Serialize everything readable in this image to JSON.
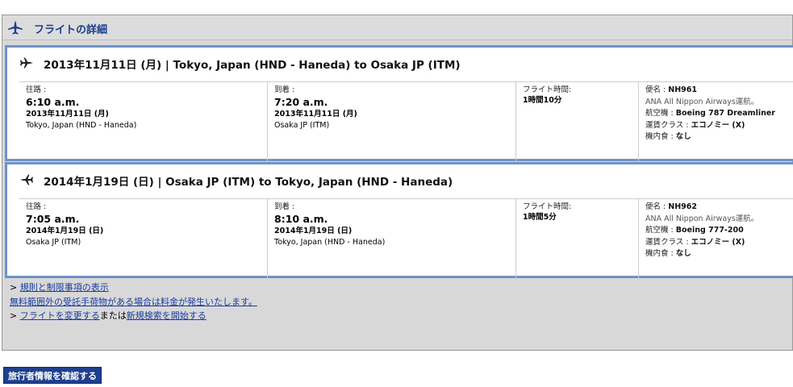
{
  "panel": {
    "title": "フライトの詳細"
  },
  "segments": [
    {
      "title": "2013年11月11日 (月) | Tokyo, Japan (HND - Haneda) to Osaka JP (ITM)",
      "depart_label": "往路 :",
      "depart_time": "6:10 a.m.",
      "depart_date": "2013年11月11日 (月)",
      "depart_place": "Tokyo, Japan (HND - Haneda)",
      "arrive_label": "到着 :",
      "arrive_time": "7:20 a.m.",
      "arrive_date": "2013年11月11日 (月)",
      "arrive_place": "Osaka JP (ITM)",
      "duration_label": "フライト時間:",
      "duration": "1時間10分",
      "flight_label": "便名 :",
      "flight_no": "NH961",
      "operator": "ANA All Nippon Airways運航。",
      "aircraft_label": "航空機 :",
      "aircraft": "Boeing 787 Dreamliner",
      "class_label": "運賃クラス :",
      "class": "エコノミー (X)",
      "meal_label": "機内食 :",
      "meal": "なし"
    },
    {
      "title": "2014年1月19日 (日) | Osaka JP (ITM) to Tokyo, Japan (HND - Haneda)",
      "depart_label": "往路 :",
      "depart_time": "7:05 a.m.",
      "depart_date": "2014年1月19日 (日)",
      "depart_place": "Osaka JP (ITM)",
      "arrive_label": "到着 :",
      "arrive_time": "8:10 a.m.",
      "arrive_date": "2014年1月19日 (日)",
      "arrive_place": "Tokyo, Japan (HND - Haneda)",
      "duration_label": "フライト時間:",
      "duration": "1時間5分",
      "flight_label": "便名 :",
      "flight_no": "NH962",
      "operator": "ANA All Nippon Airways運航。",
      "aircraft_label": "航空機 :",
      "aircraft": "Boeing 777-200",
      "class_label": "運賃クラス :",
      "class": "エコノミー (X)",
      "meal_label": "機内食 :",
      "meal": "なし"
    }
  ],
  "links": {
    "marker": ">",
    "rules": "規則と制限事項の表示",
    "baggage": "無料範囲外の受託手荷物がある場合は料金が発生いたします。",
    "change": "フライトを変更する",
    "or_text": "または",
    "new_search": "新規検索を開始する"
  },
  "button": {
    "confirm": "旅行者情報を確認する"
  },
  "colors": {
    "link": "#1a3da0",
    "segment_border": "#6e93c6",
    "button_bg": "#1f3f8f",
    "header_title": "#1a3d8f"
  },
  "icons": {
    "header": "airplane-up-icon",
    "outbound": "airplane-right-icon",
    "return": "airplane-left-icon"
  }
}
